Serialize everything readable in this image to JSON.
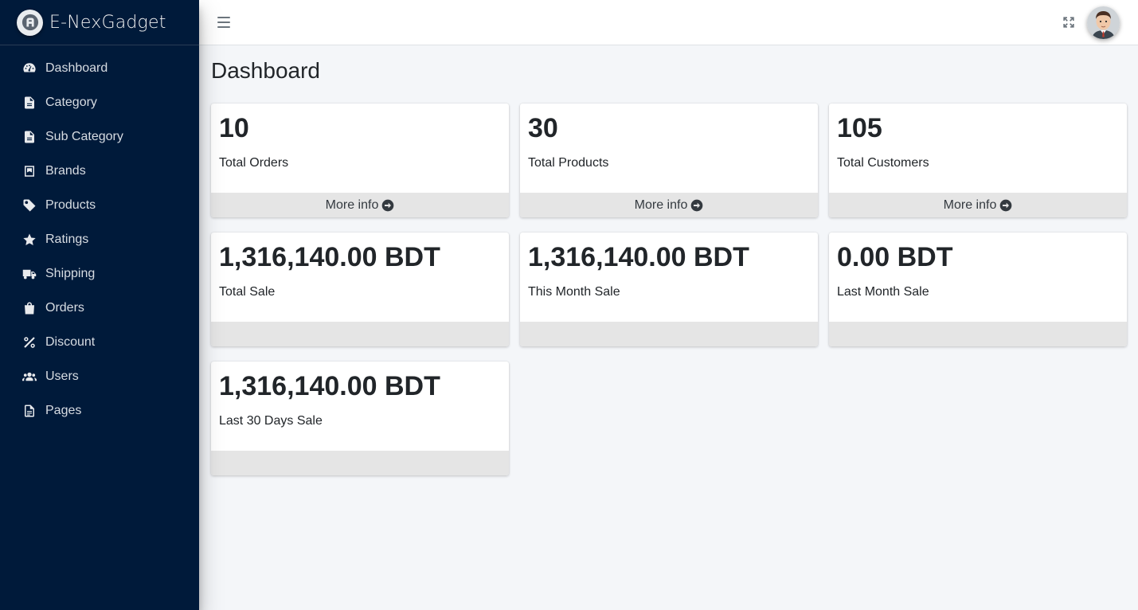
{
  "brand": {
    "name": "E-NexGadget",
    "logo_icon": "brand-logo-icon"
  },
  "sidebar": {
    "items": [
      {
        "label": "Dashboard",
        "icon": "tachometer-icon"
      },
      {
        "label": "Category",
        "icon": "file-icon"
      },
      {
        "label": "Sub Category",
        "icon": "file-icon"
      },
      {
        "label": "Brands",
        "icon": "book-icon"
      },
      {
        "label": "Products",
        "icon": "tag-icon"
      },
      {
        "label": "Ratings",
        "icon": "star-icon"
      },
      {
        "label": "Shipping",
        "icon": "truck-icon"
      },
      {
        "label": "Orders",
        "icon": "shopping-bag-icon"
      },
      {
        "label": "Discount",
        "icon": "percent-icon"
      },
      {
        "label": "Users",
        "icon": "users-icon"
      },
      {
        "label": "Pages",
        "icon": "file-alt-icon"
      }
    ]
  },
  "topbar": {
    "menu_icon": "hamburger-icon",
    "expand_icon": "expand-icon",
    "avatar_icon": "user-avatar"
  },
  "main": {
    "title": "Dashboard",
    "cards": [
      {
        "value": "10",
        "label": "Total Orders",
        "footer": "More info"
      },
      {
        "value": "30",
        "label": "Total Products",
        "footer": "More info"
      },
      {
        "value": "105",
        "label": "Total Customers",
        "footer": "More info"
      },
      {
        "value": "1,316,140.00 BDT",
        "label": "Total Sale",
        "footer": ""
      },
      {
        "value": "1,316,140.00 BDT",
        "label": "This Month Sale",
        "footer": ""
      },
      {
        "value": "0.00 BDT",
        "label": "Last Month Sale",
        "footer": ""
      },
      {
        "value": "1,316,140.00 BDT",
        "label": "Last 30 Days Sale",
        "footer": ""
      }
    ]
  },
  "colors": {
    "sidebar_bg": "#001a3a",
    "page_bg": "#f4f6f9",
    "card_footer_bg": "#e5e5e5"
  }
}
